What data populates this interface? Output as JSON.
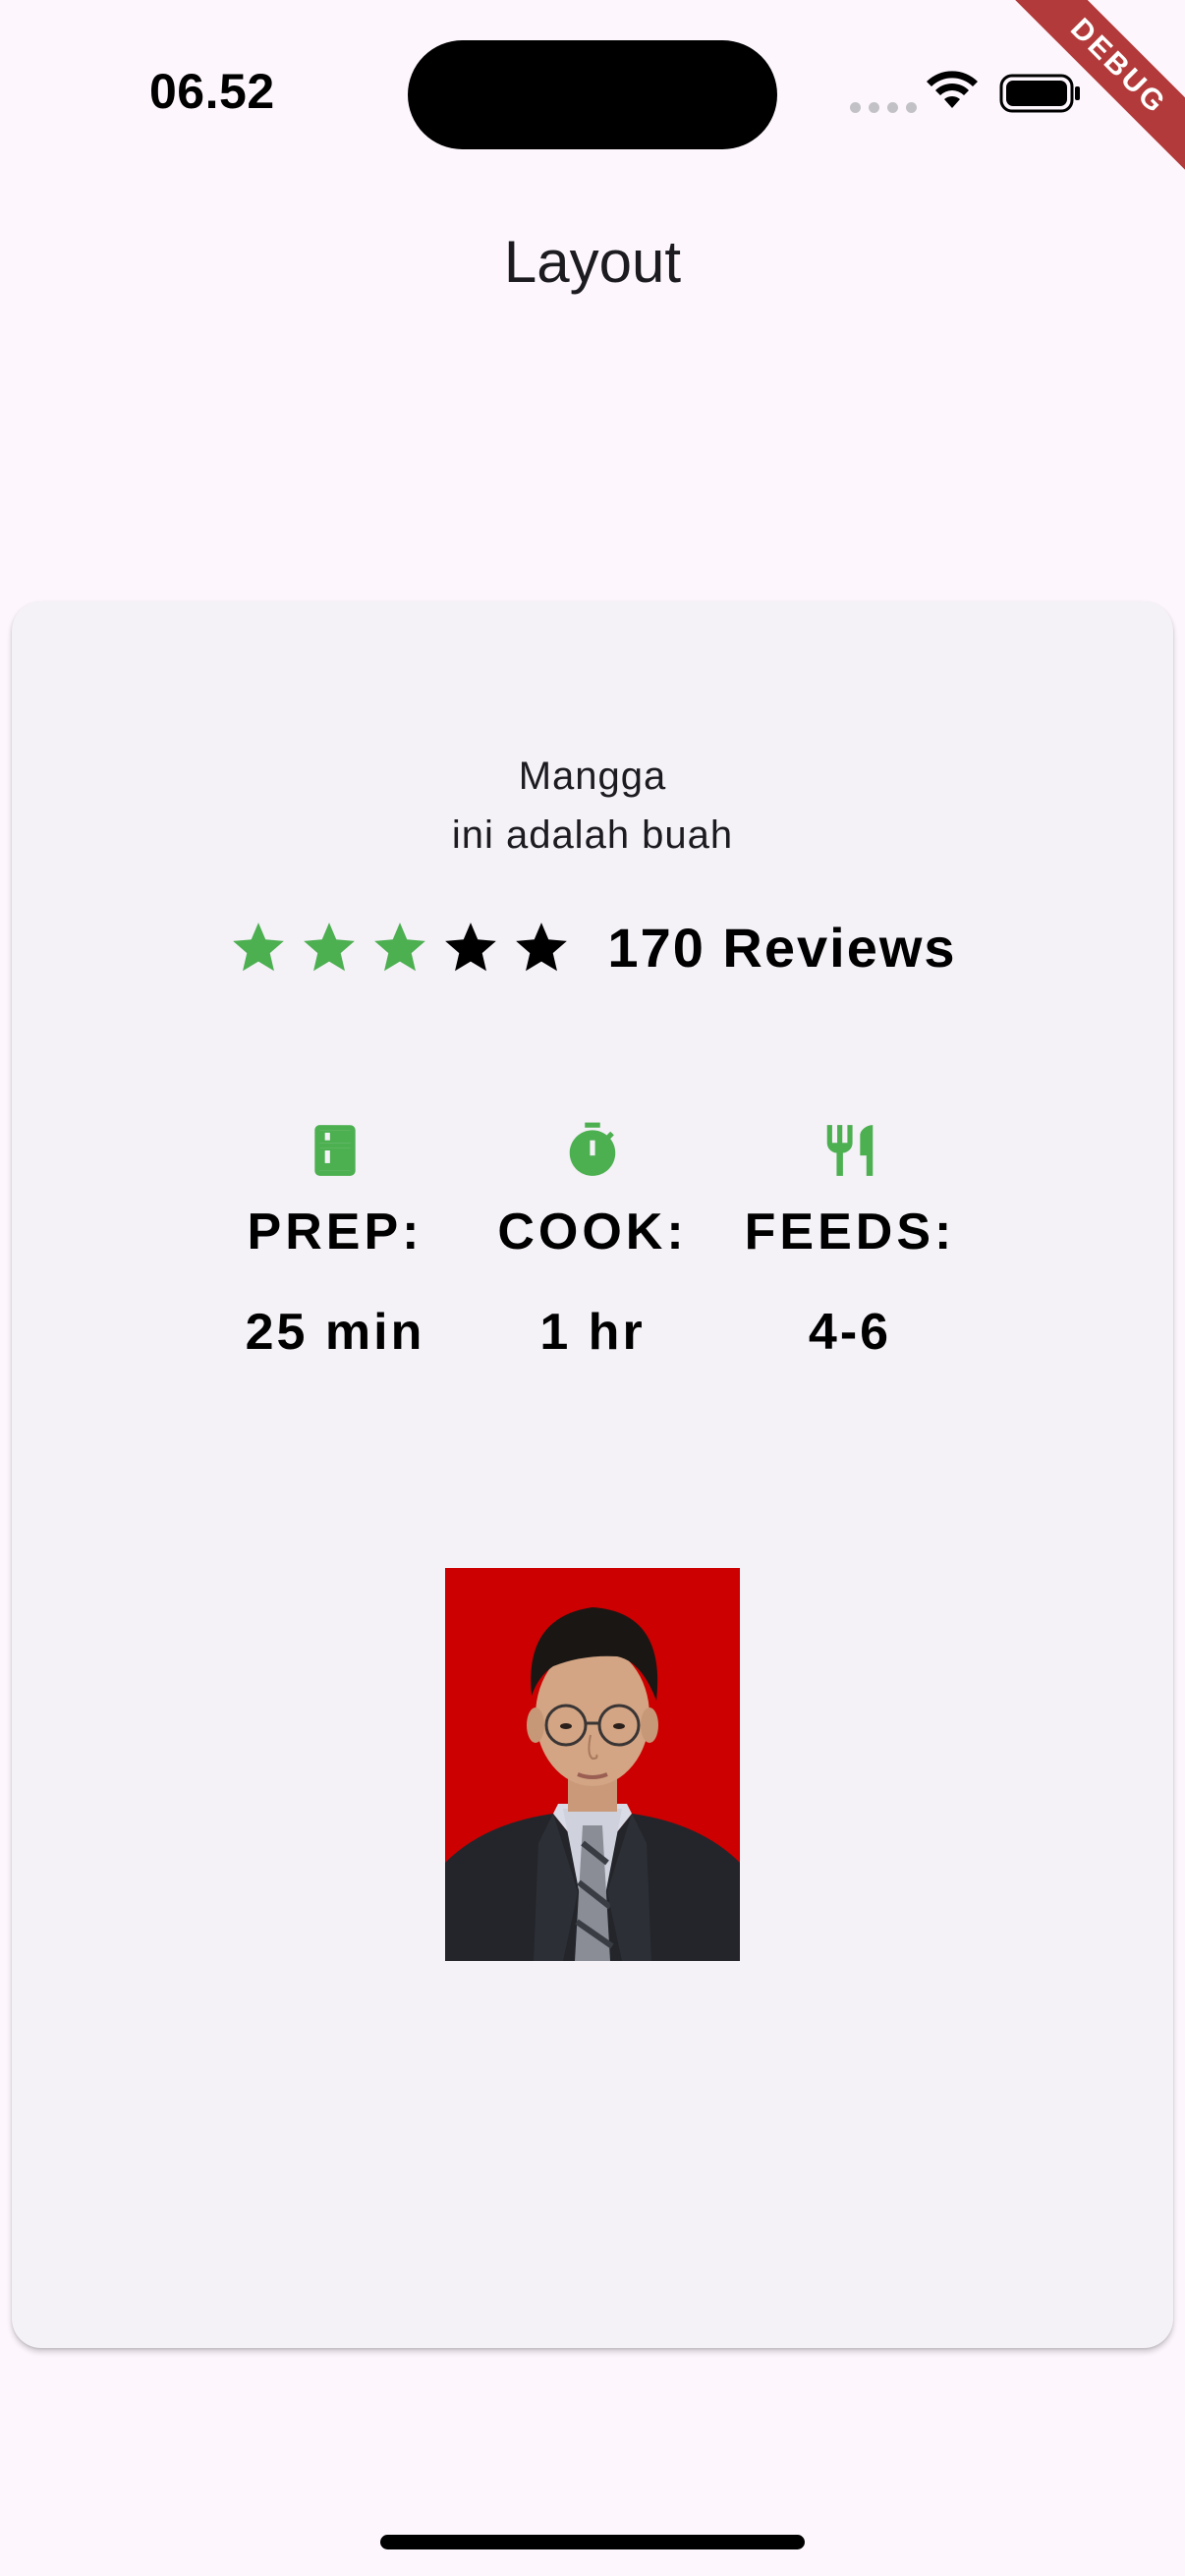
{
  "status_bar": {
    "time": "06.52",
    "icons": [
      "signal-dots-icon",
      "wifi-icon",
      "battery-icon"
    ]
  },
  "debug_banner": "DEBUG",
  "app_bar": {
    "title": "Layout"
  },
  "card": {
    "title_line1": "Mangga",
    "title_line2": "ini adalah buah",
    "rating": {
      "stars_filled": 3,
      "stars_total": 5,
      "filled_color": "#4caf50",
      "empty_color": "#000000",
      "reviews": "170 Reviews"
    },
    "info": [
      {
        "icon": "kitchen-icon",
        "label": "PREP:",
        "value": "25 min"
      },
      {
        "icon": "timer-icon",
        "label": "COOK:",
        "value": "1 hr"
      },
      {
        "icon": "restaurant-icon",
        "label": "FEEDS:",
        "value": "4-6"
      }
    ],
    "icon_color": "#4caf50",
    "photo": {
      "description_icon": "portrait-photo",
      "background_color": "#cc0000"
    }
  }
}
